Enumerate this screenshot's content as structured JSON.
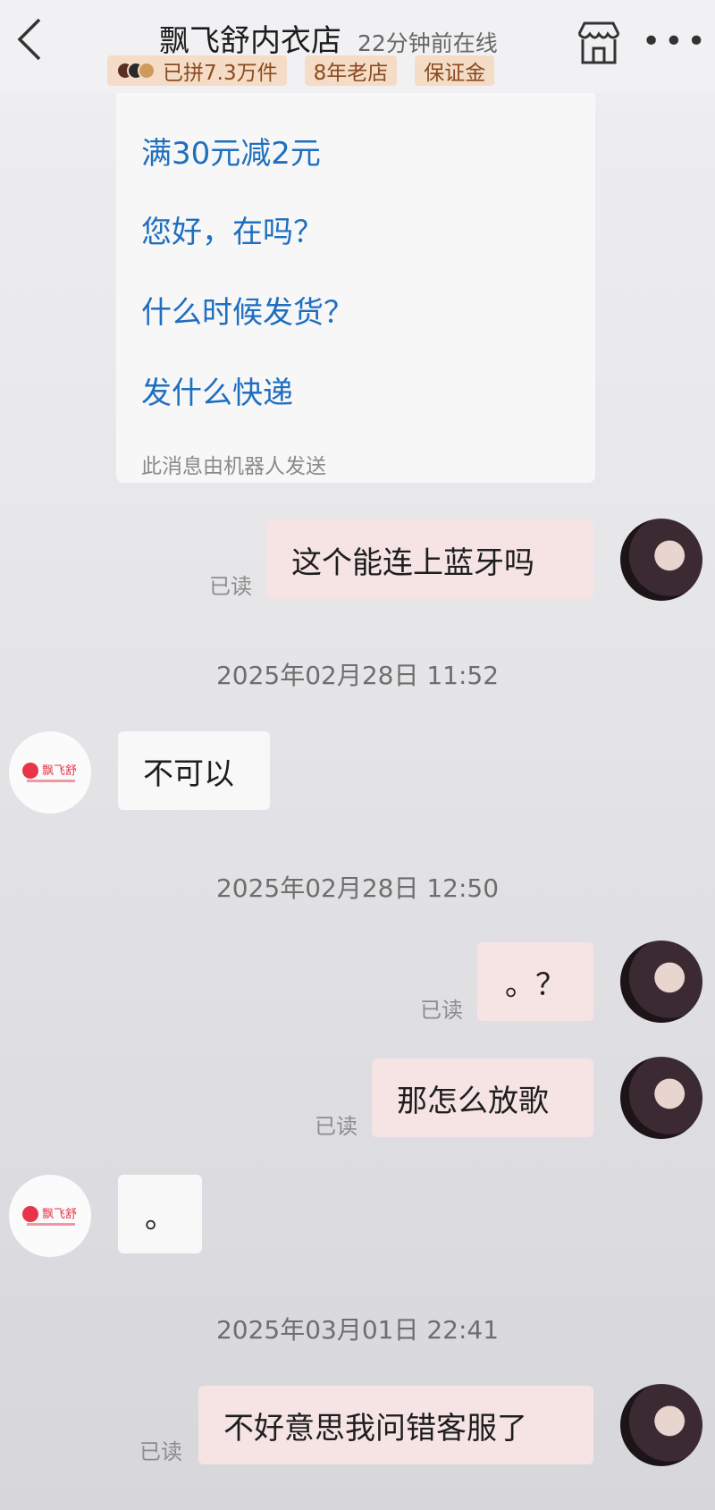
{
  "header": {
    "shop_name": "飘飞舒内衣店",
    "online_status": "22分钟前在线",
    "badges": {
      "sold": "已拼7.3万件",
      "years": "8年老店",
      "deposit": "保证金"
    },
    "icons": {
      "back": "chevron-left-icon",
      "store": "store-icon",
      "more": "more-dots-icon"
    }
  },
  "robot_card": {
    "questions": [
      "满30元减2元",
      "您好，在吗？",
      "什么时候发货？",
      "发什么快递"
    ],
    "note": "此消息由机器人发送"
  },
  "messages": {
    "m1": {
      "text": "这个能连上蓝牙吗",
      "status": "已读"
    },
    "t1": "2025年02月28日 11:52",
    "m2": {
      "text": "不可以"
    },
    "t2": "2025年02月28日 12:50",
    "m3": {
      "text": "。？",
      "status": "已读"
    },
    "m4": {
      "text": "那怎么放歌",
      "status": "已读"
    },
    "m5": {
      "text": "。"
    },
    "t3": "2025年03月01日 22:41",
    "m6": {
      "text": "不好意思我问错客服了",
      "status": "已读"
    }
  },
  "colors": {
    "link": "#1f6fbf",
    "badge_bg": "#f5dcc6",
    "mine_bubble": "#f6e4e4",
    "shop_logo": "#e8354a"
  }
}
